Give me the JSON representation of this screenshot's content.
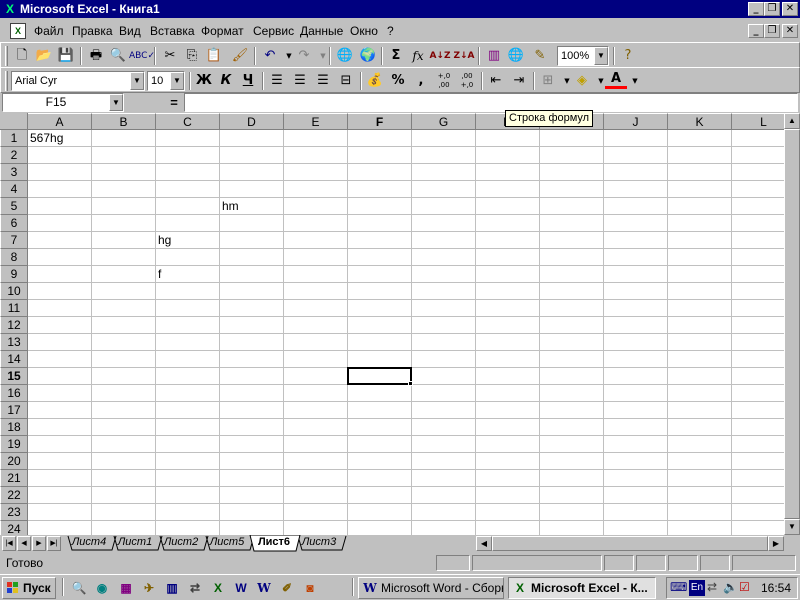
{
  "window": {
    "title": "Microsoft Excel - Книга1",
    "app_icon": "excel-x-icon",
    "controls": {
      "minimize": "_",
      "maximize": "❐",
      "close": "✕"
    }
  },
  "menu": {
    "items": [
      "Файл",
      "Правка",
      "Вид",
      "Вставка",
      "Формат",
      "Сервис",
      "Данные",
      "Окно",
      "?"
    ],
    "doc_controls": {
      "minimize": "_",
      "restore": "❐",
      "close": "✕"
    }
  },
  "standard_toolbar": {
    "zoom": "100%"
  },
  "formatting_toolbar": {
    "font": "Arial Cyr",
    "size": "10",
    "bold": "Ж",
    "italic": "К",
    "underline": "Ч",
    "percent": "%",
    "comma": ",",
    "inc_decimal": "+,0\n,00",
    "dec_decimal": ",00\n+,0"
  },
  "formula_bar": {
    "name_box": "F15",
    "equals": "=",
    "formula": "",
    "tooltip": "Строка формул"
  },
  "grid": {
    "columns": [
      "A",
      "B",
      "C",
      "D",
      "E",
      "F",
      "G",
      "H",
      "I",
      "J",
      "K",
      "L"
    ],
    "rows": [
      "1",
      "2",
      "3",
      "4",
      "5",
      "6",
      "7",
      "8",
      "9",
      "10",
      "11",
      "12",
      "13",
      "14",
      "15",
      "16",
      "17",
      "18",
      "19",
      "20",
      "21",
      "22",
      "23",
      "24"
    ],
    "active_column": "F",
    "active_row": "15",
    "cells": {
      "A1": "567hg",
      "D5": "hm",
      "C7": "hg",
      "C9": "f"
    }
  },
  "sheets": {
    "tabs": [
      "Лист4",
      "Лист1",
      "Лист2",
      "Лист5",
      "Лист6",
      "Лист3"
    ],
    "active": "Лист6"
  },
  "status": {
    "text": "Готово"
  },
  "taskbar": {
    "start": "Пуск",
    "tasks": [
      {
        "label": "Microsoft Word - Сборн...",
        "icon": "word-icon"
      },
      {
        "label": "Microsoft Excel - К...",
        "icon": "excel-icon"
      }
    ],
    "tray_lang": "En",
    "clock": "16:54"
  }
}
